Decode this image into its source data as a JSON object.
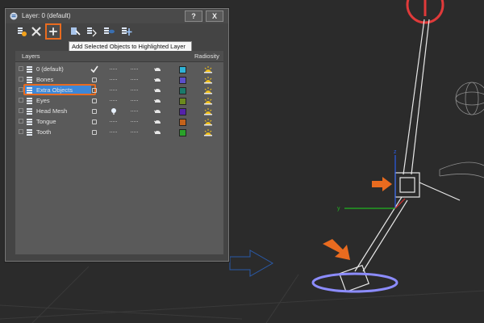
{
  "window": {
    "title": "Layer: 0 (default)",
    "help_label": "?",
    "close_label": "X"
  },
  "toolbar": {
    "buttons": [
      "create-layer",
      "delete-layer",
      "add-selected",
      "select-objects",
      "highlight-layer",
      "hide-all",
      "freeze-all"
    ],
    "tooltip": "Add Selected Objects to Highlighted Layer"
  },
  "table": {
    "headers": {
      "layers": "Layers",
      "radiosity": "Radiosity"
    },
    "rows": [
      {
        "name": "0 (default)",
        "color": "#2fb3d6",
        "current": true
      },
      {
        "name": "Bones",
        "color": "#5b4ec9",
        "current": false
      },
      {
        "name": "Extra Objects",
        "color": "#1a7a6a",
        "current": false,
        "selected": true
      },
      {
        "name": "Eyes",
        "color": "#6b8a1d",
        "current": false
      },
      {
        "name": "Head Mesh",
        "color": "#5522aa",
        "current": false,
        "light": true
      },
      {
        "name": "Tongue",
        "color": "#c4621a",
        "current": false
      },
      {
        "name": "Tooth",
        "color": "#2aa22a",
        "current": false
      }
    ]
  },
  "colors": {
    "accent": "#e96b1f",
    "selection": "#3c87d8"
  }
}
